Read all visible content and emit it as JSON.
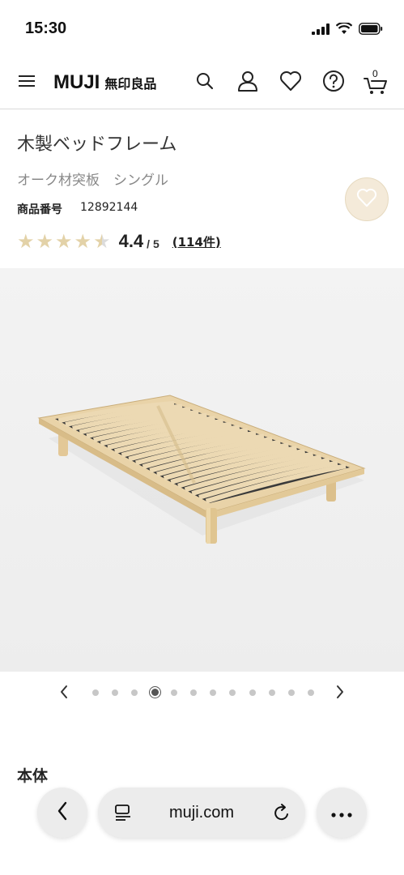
{
  "status": {
    "time": "15:30"
  },
  "header": {
    "brand_en": "MUJI",
    "brand_jp": "無印良品",
    "cart_count": "0"
  },
  "product": {
    "title": "木製ベッドフレーム",
    "variant": "オーク材突板　シングル",
    "number_label": "商品番号",
    "number": "12892144",
    "rating": 4.4,
    "rating_value": "4.4",
    "rating_max": "/ 5",
    "review_count": "(114件)"
  },
  "carousel": {
    "total_slides": 12,
    "active_slide": 4
  },
  "section": {
    "title": "本体"
  },
  "browser": {
    "url": "muji.com"
  },
  "colors": {
    "star_fill": "#e3d2a8",
    "star_empty": "#dcdcdc",
    "accent_fav": "#f4ead9",
    "hero_bg": "#f1f1f1"
  }
}
